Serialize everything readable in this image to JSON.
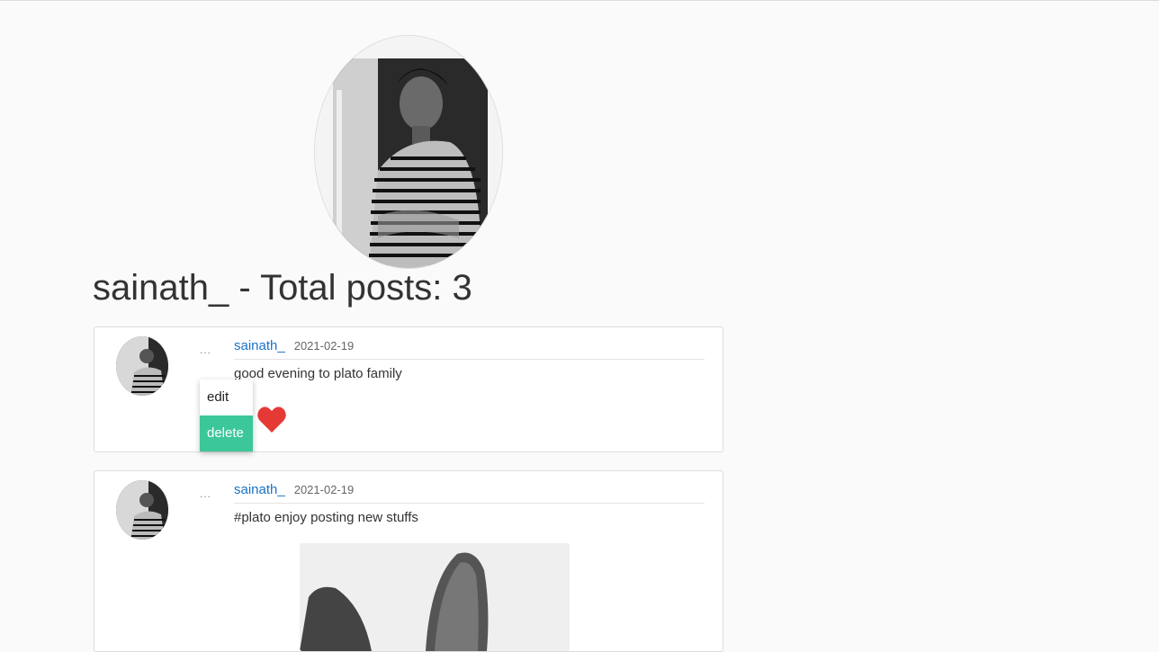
{
  "profile": {
    "username": "sainath_",
    "title_separator": " - ",
    "total_posts_label": "Total posts:",
    "total_posts": "3"
  },
  "posts": [
    {
      "username": "sainath_",
      "date": "2021-02-19",
      "text": "good evening to plato family",
      "liked": true
    },
    {
      "username": "sainath_",
      "date": "2021-02-19",
      "text": "#plato enjoy posting new stuffs",
      "has_image": true
    }
  ],
  "menu": {
    "dots": "...",
    "edit_label": "edit",
    "delete_label": "delete"
  },
  "colors": {
    "accent_green": "#3cc79a",
    "link_blue": "#1a73c8",
    "heart_red": "#e53935"
  },
  "icons": {
    "more": "more-dots-icon",
    "like": "heart-icon"
  }
}
